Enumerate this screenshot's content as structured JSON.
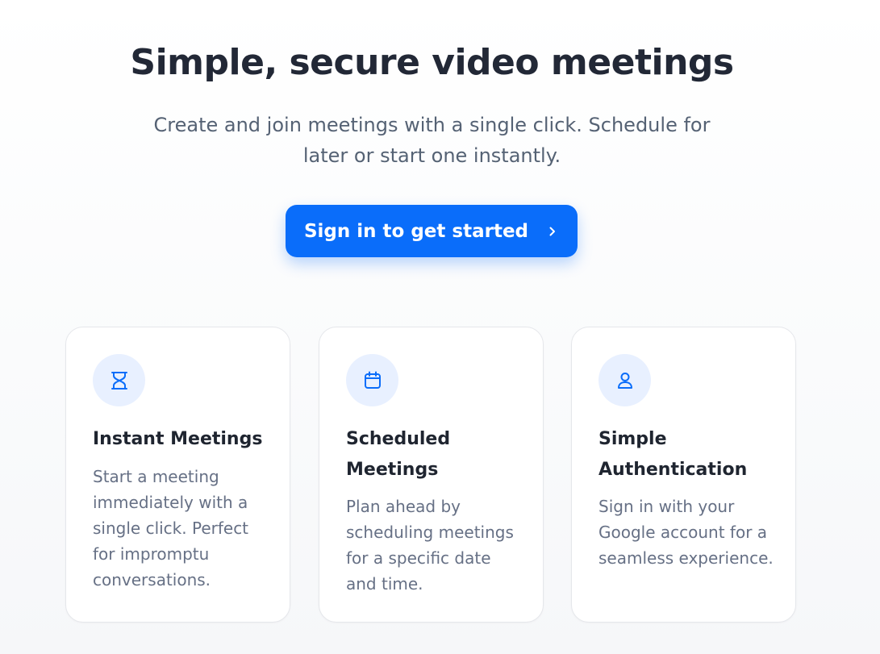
{
  "hero": {
    "title": "Simple, secure video meetings",
    "subtitle": "Create and join meetings with a single click. Schedule for later or start one instantly.",
    "cta_label": "Sign in to get started"
  },
  "features": [
    {
      "icon": "hourglass-icon",
      "title": "Instant Meetings",
      "description": "Start a meeting immediately with a single click. Perfect for impromptu conversations."
    },
    {
      "icon": "calendar-icon",
      "title": "Scheduled Meetings",
      "description": "Plan ahead by scheduling meetings for a specific date and time."
    },
    {
      "icon": "user-icon",
      "title": "Simple Authentication",
      "description": "Sign in with your Google account for a seamless experience."
    }
  ],
  "colors": {
    "accent": "#0a6dfa",
    "icon_bg": "#e8f0ff",
    "title_text": "#222836",
    "body_text": "#667085"
  }
}
